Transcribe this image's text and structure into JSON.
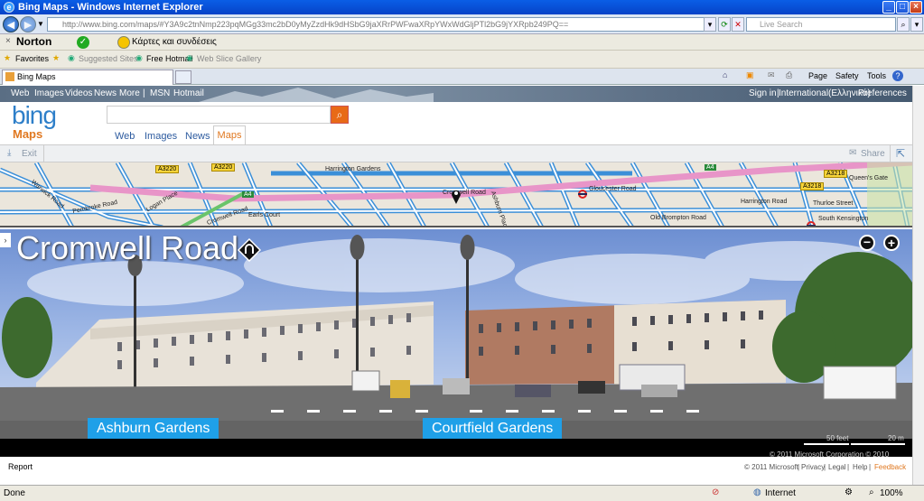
{
  "window": {
    "title": "Bing Maps - Windows Internet Explorer",
    "ie_icon": "e"
  },
  "address": {
    "url": "http://www.bing.com/maps/#Y3A9c2tnNmp223pqMGg33mc2bD0yMyZzdHk9dHSbG9jaXRrPWFwaXRpYWxWdGljPTl2bG9jYXRpb249PQ==",
    "search_placeholder": "Live Search"
  },
  "norton": {
    "label": "Norton",
    "cards_label": "Κάρτες και συνδέσεις"
  },
  "favorites": {
    "favorites_label": "Favorites",
    "items": [
      "Suggested Sites",
      "Free Hotmail",
      "Web Slice Gallery"
    ]
  },
  "tab": {
    "title": "Bing Maps"
  },
  "command_bar": {
    "page": "Page",
    "safety": "Safety",
    "tools": "Tools"
  },
  "bing": {
    "topnav": [
      "Web",
      "Images",
      "Videos",
      "News",
      "More",
      "MSN",
      "Hotmail"
    ],
    "topnav_right": [
      "Sign in",
      "International(Ελληνικά)",
      "Preferences"
    ],
    "logo": "bing",
    "maps_label": "Maps",
    "tabs": [
      "Web",
      "Images",
      "News"
    ],
    "active_tab": "Maps",
    "exit_label": "Exit",
    "share_label": "Share"
  },
  "map": {
    "street_labels": [
      "Warwick Road",
      "Pembroke Road",
      "Logan Place",
      "Cromwell Road",
      "Earls Court",
      "Cromwell Road",
      "Gloucester Road",
      "Harrington Gardens",
      "Ashburn Place",
      "Old Brompton Road",
      "Harrington Road",
      "Thurloe Street",
      "South Kensington",
      "Queen's Gate"
    ],
    "road_badges": [
      "A3220",
      "A3220",
      "A4",
      "A4",
      "A3218",
      "A3218"
    ]
  },
  "panorama": {
    "title": "Cromwell Road",
    "labels": [
      "Ashburn Gardens",
      "Courtfield Gardens"
    ],
    "scale": [
      "50 feet",
      "20 m"
    ],
    "copyright": "© 2011 Microsoft Corporation  © 2010 NAVTEQ"
  },
  "footer": {
    "report": "Report",
    "links": [
      "© 2011 Microsoft",
      "Privacy",
      "Legal",
      "Help",
      "Feedback"
    ]
  },
  "status": {
    "left": "Done",
    "zone": "Internet",
    "zoom": "100%"
  },
  "colors": {
    "bing_blue": "#2e7fc9",
    "maps_orange": "#e07820",
    "label_blue": "#1fa0e8",
    "road_pink": "#e895c8",
    "road_blue": "#3b8fd8"
  }
}
